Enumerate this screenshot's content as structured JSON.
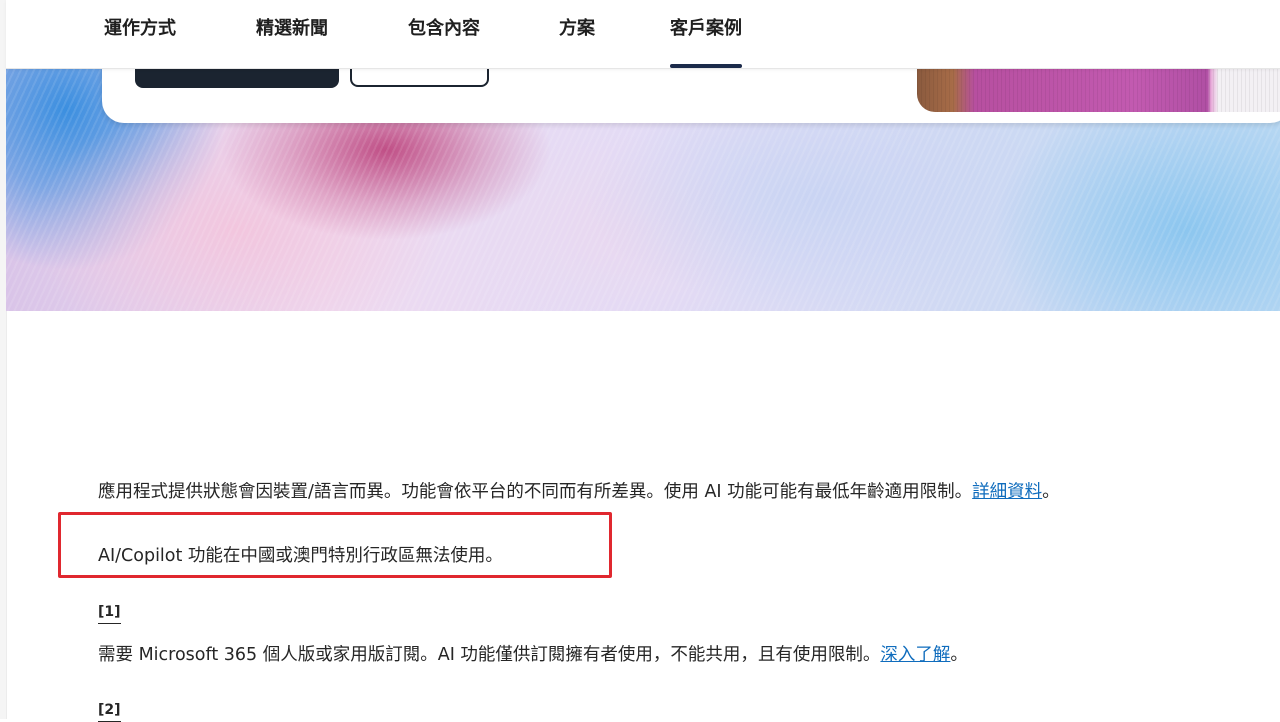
{
  "nav": {
    "items": [
      {
        "label": "運作方式",
        "active": false
      },
      {
        "label": "精選新聞",
        "active": false
      },
      {
        "label": "包含內容",
        "active": false
      },
      {
        "label": "方案",
        "active": false
      },
      {
        "label": "客戶案例",
        "active": true
      }
    ]
  },
  "footnotes": {
    "availability_text": "應用程式提供狀態會因裝置/語言而異。功能會依平台的不同而有所差異。使用 AI 功能可能有最低年齡適用限制。",
    "availability_link": "詳細資料",
    "availability_end": "。",
    "region_note": "AI/Copilot 功能在中國或澳門特別行政區無法使用。",
    "note1_label": "[1]",
    "note1_text": "需要 Microsoft 365 個人版或家用版訂閱。AI 功能僅供訂閱擁有者使用，不能共用，且有使用限制。",
    "note1_link": "深入了解",
    "note1_end": "。",
    "note2_label": "[2]"
  },
  "colors": {
    "link": "#0f6cbd",
    "highlight_border": "#e0282f",
    "nav_active": "#1b2a4a"
  }
}
